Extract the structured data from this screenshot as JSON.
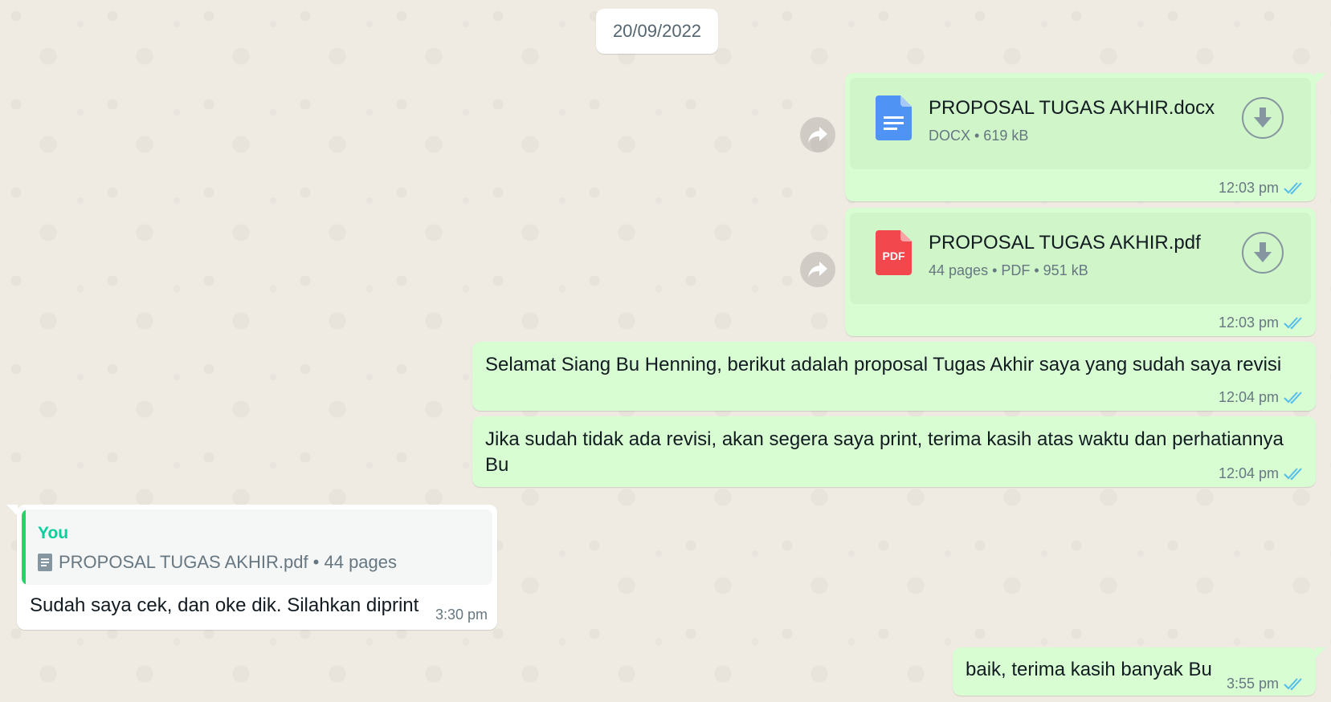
{
  "date_chip": "20/09/2022",
  "colors": {
    "bubble_out": "#d9fdd3",
    "bubble_in": "#ffffff",
    "read_ticks": "#53bdeb",
    "quote_accent": "#25d366",
    "quote_author": "#06cf9c"
  },
  "messages": [
    {
      "type": "document",
      "direction": "out",
      "file_name": "PROPOSAL TUGAS AKHIR.docx",
      "file_meta": "DOCX • 619 kB",
      "icon": "docx-file-icon",
      "time": "12:03 pm",
      "status": "read"
    },
    {
      "type": "document",
      "direction": "out",
      "file_name": "PROPOSAL TUGAS AKHIR.pdf",
      "file_meta": "44 pages • PDF • 951 kB",
      "icon": "pdf-file-icon",
      "icon_label": "PDF",
      "time": "12:03 pm",
      "status": "read"
    },
    {
      "type": "text",
      "direction": "out",
      "text": "Selamat Siang Bu Henning, berikut adalah proposal Tugas Akhir saya yang sudah saya revisi",
      "time": "12:04 pm",
      "status": "read"
    },
    {
      "type": "text",
      "direction": "out",
      "text": "Jika sudah tidak ada revisi, akan segera saya print, terima kasih atas waktu dan perhatiannya Bu",
      "time": "12:04 pm",
      "status": "read"
    },
    {
      "type": "reply",
      "direction": "in",
      "quote_author": "You",
      "quote_text": "PROPOSAL TUGAS AKHIR.pdf • 44 pages",
      "text": "Sudah saya cek, dan oke dik. Silahkan diprint",
      "time": "3:30 pm"
    },
    {
      "type": "text",
      "direction": "out",
      "text": "baik, terima kasih banyak Bu",
      "time": "3:55 pm",
      "status": "read"
    }
  ]
}
